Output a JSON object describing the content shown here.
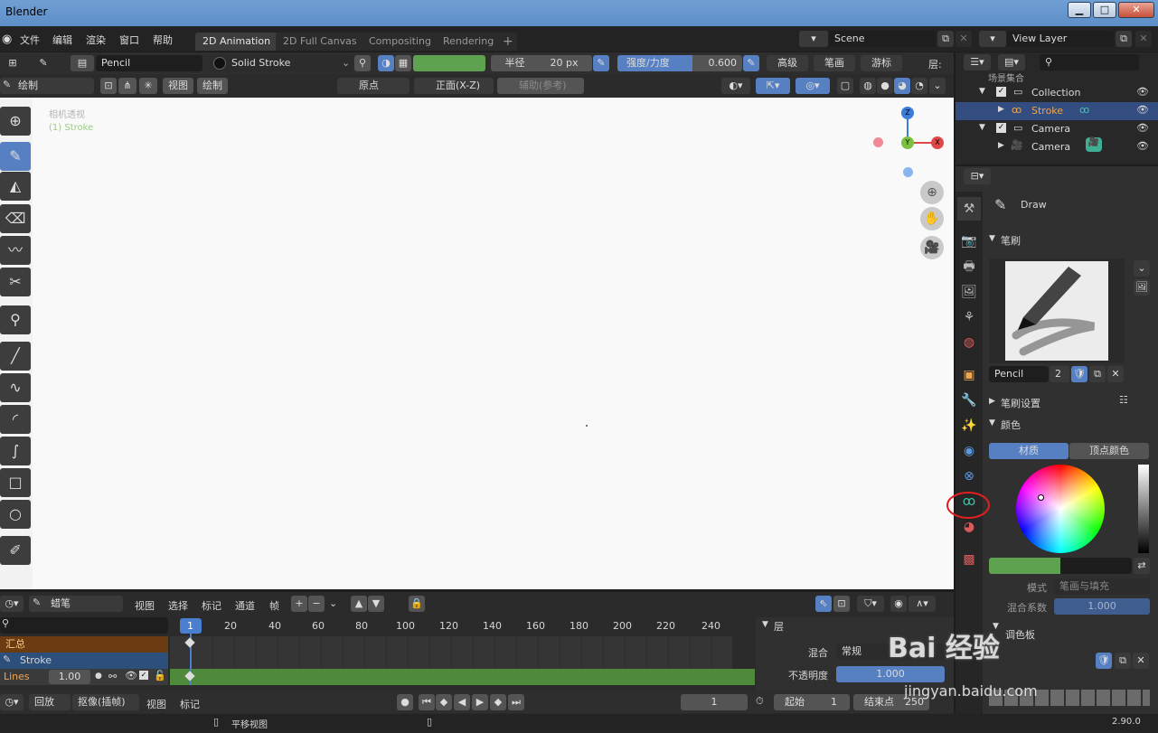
{
  "window": {
    "title": "Blender",
    "min": "▁",
    "max": "□",
    "close": "✕"
  },
  "menu": [
    "文件",
    "编辑",
    "渲染",
    "窗口",
    "帮助"
  ],
  "workspaces": [
    "2D Animation",
    "2D Full Canvas",
    "Compositing",
    "Rendering"
  ],
  "add_tab": "+",
  "scene": {
    "label": "Scene",
    "view_layer": "View Layer"
  },
  "tool_header": {
    "brush": "Pencil",
    "material": "Solid Stroke",
    "radius_label": "半径",
    "radius_value": "20 px",
    "strength_label": "强度/力度",
    "strength_value": "0.600",
    "advanced": "高级",
    "stroke": "笔画",
    "cursor": "游标",
    "layer": "层:",
    "stroke_color": "#5ea24f"
  },
  "view_header": {
    "mode": "绘制",
    "view": "视图",
    "draw": "绘制",
    "origin": "原点",
    "plane": "正面(X-Z)",
    "guides": "辅助(参考)"
  },
  "viewport": {
    "overlay1": "相机透视",
    "overlay2": "(1) Stroke"
  },
  "gizmo": {
    "z": "Z",
    "y": "Y",
    "x": "X"
  },
  "outliner": {
    "root": "场景集合",
    "collection": "Collection",
    "stroke": "Stroke",
    "camera_obj": "Camera",
    "camera_data": "Camera"
  },
  "props": {
    "tool_name": "Draw",
    "brush_panel": "笔刷",
    "brush_name": "Pencil",
    "brush_users": "2",
    "brush_settings": "笔刷设置",
    "color_panel": "颜色",
    "material_tab": "材质",
    "vertex_tab": "顶点颜色",
    "mode_label": "模式",
    "mode_value": "笔画与填充",
    "mix_label": "混合系数",
    "mix_value": "1.000",
    "palette": "调色板",
    "color": "#5ea24f"
  },
  "timeline": {
    "mode": "蜡笔",
    "menus": [
      "视图",
      "选择",
      "标记",
      "通道",
      "帧"
    ],
    "frames": [
      "1",
      "20",
      "40",
      "60",
      "80",
      "100",
      "120",
      "140",
      "160",
      "180",
      "200",
      "220",
      "240"
    ],
    "summary": "汇总",
    "object": "Stroke",
    "layer": "Lines",
    "layer_opacity": "1.00",
    "layer_panel": "层",
    "blend_label": "混合",
    "blend_value": "常规",
    "opacity_label": "不透明度",
    "opacity_value": "1.000"
  },
  "playback": {
    "playback": "回放",
    "keying": "抠像(插帧)",
    "view": "视图",
    "markers": "标记",
    "current": "1",
    "start_label": "起始",
    "start": "1",
    "end_label": "结束点",
    "end": "250"
  },
  "status": {
    "pan": "平移视图",
    "version": "2.90.0"
  },
  "watermark": {
    "brand": "Bai 经验",
    "url": "jingyan.baidu.com"
  }
}
